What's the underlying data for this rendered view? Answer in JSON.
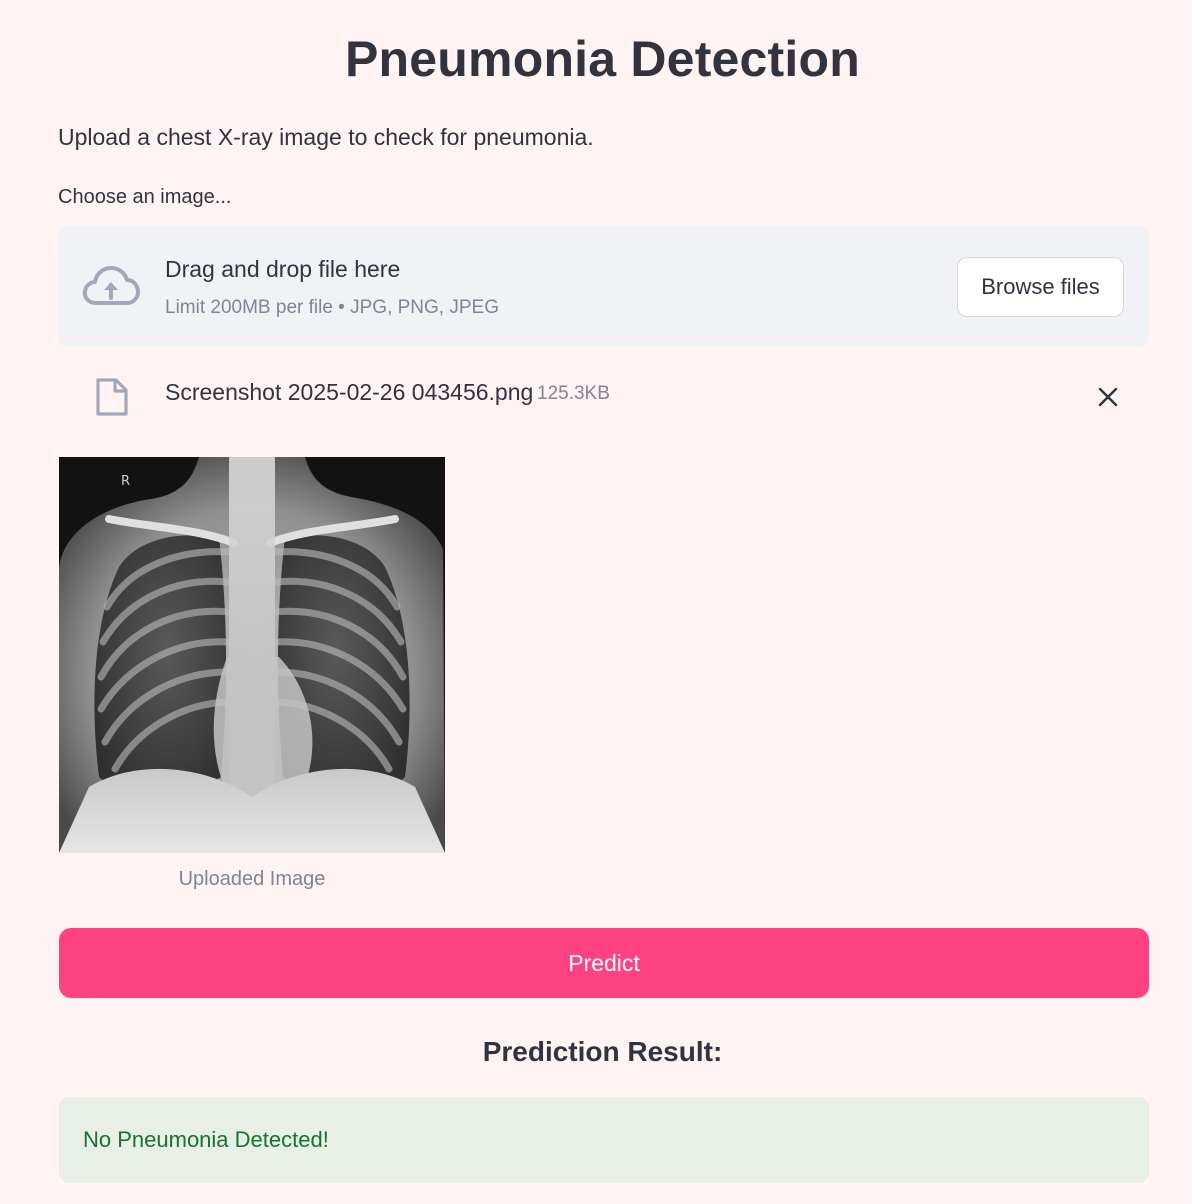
{
  "page": {
    "title": "Pneumonia Detection",
    "subtitle": "Upload a chest X-ray image to check for pneumonia."
  },
  "uploader": {
    "label": "Choose an image...",
    "drop_title": "Drag and drop file here",
    "limit_text": "Limit 200MB per file • JPG, PNG, JPEG",
    "browse_label": "Browse files",
    "icon": "cloud-upload-icon"
  },
  "uploaded_file": {
    "name": "Screenshot 2025-02-26 043456.png",
    "size": "125.3KB",
    "icon": "file-icon",
    "remove_icon": "close-icon"
  },
  "preview": {
    "caption": "Uploaded Image",
    "marker": "R"
  },
  "actions": {
    "predict_label": "Predict"
  },
  "result": {
    "heading": "Prediction Result:",
    "message": "No Pneumonia Detected!"
  },
  "colors": {
    "background": "#fff4f3",
    "primary": "#ff4282",
    "dropzone": "#f0f2f6",
    "success_bg": "#e8efe4",
    "success_text": "#177233"
  }
}
